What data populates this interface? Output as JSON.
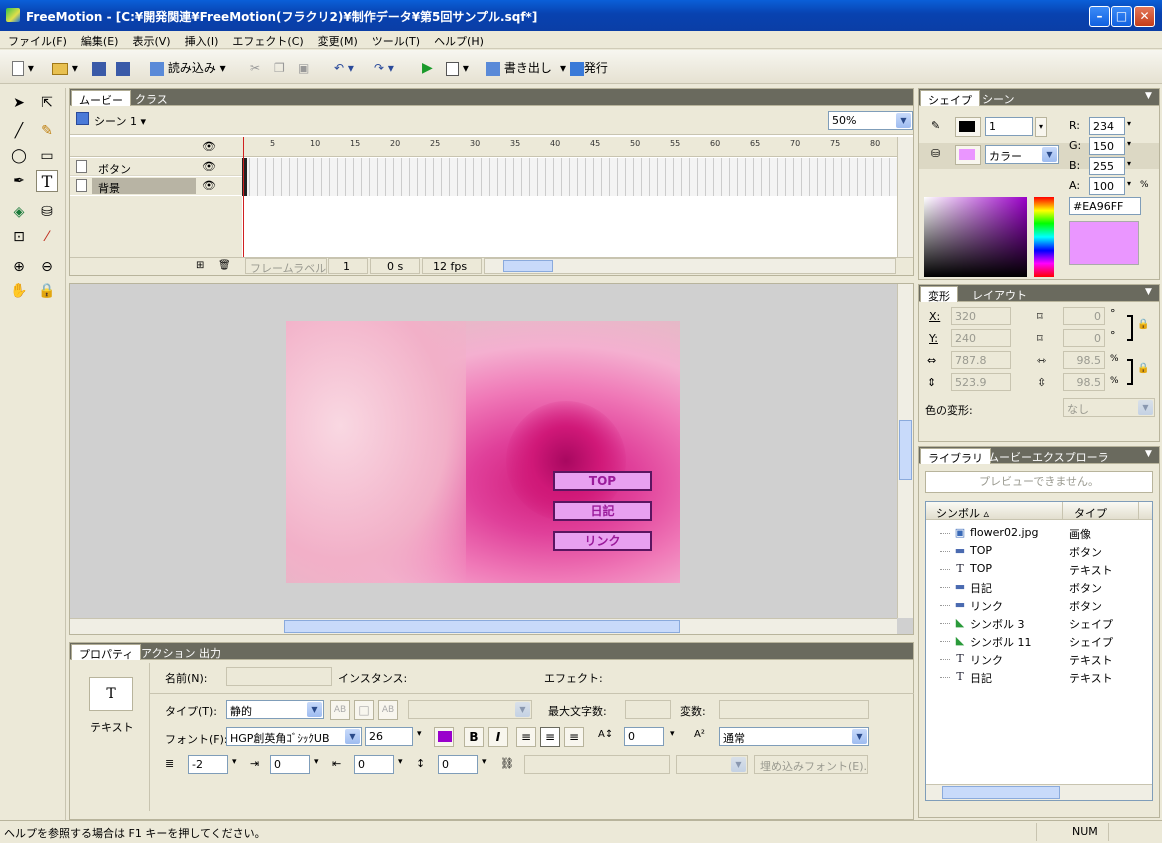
{
  "window": {
    "title": "FreeMotion - [C:¥開発関連¥FreeMotion(フラクリ2)¥制作データ¥第5回サンプル.sqf*]"
  },
  "menu": [
    "ファイル(F)",
    "編集(E)",
    "表示(V)",
    "挿入(I)",
    "エフェクト(C)",
    "変更(M)",
    "ツール(T)",
    "ヘルプ(H)"
  ],
  "toolbar": {
    "import_label": "読み込み",
    "export_label": "書き出し",
    "publish_label": "発行"
  },
  "movie_panel": {
    "tabs": [
      "ムービー",
      "クラス"
    ],
    "scene_label": "シーン 1",
    "zoom": "50%",
    "layers": [
      "ボタン",
      "背景"
    ],
    "ruler": [
      "5",
      "10",
      "15",
      "20",
      "25",
      "30",
      "35",
      "40",
      "45",
      "50",
      "55",
      "60",
      "65",
      "70",
      "75",
      "80"
    ],
    "frame_label_placeholder": "フレームラベル",
    "frame": "1",
    "time": "0 s",
    "fps": "12 fps"
  },
  "stage": {
    "buttons": [
      "TOP",
      "日記",
      "リンク"
    ]
  },
  "properties": {
    "tabs": [
      "プロパティ",
      "アクション",
      "出力"
    ],
    "object_type": "テキスト",
    "name_label": "名前(N):",
    "instance_label": "インスタンス:",
    "effect_label": "エフェクト:",
    "type_label": "タイプ(T):",
    "type_value": "静的",
    "maxchars_label": "最大文字数:",
    "var_label": "変数:",
    "font_label": "フォント(F):",
    "font_value": "HGP創英角ｺﾞｼｯｸUB",
    "font_size": "26",
    "spacing": "0",
    "baseline": "通常",
    "indent_left": "-2",
    "indent_a": "0",
    "indent_b": "0",
    "line_spacing": "0",
    "embed_font_label": "埋め込みフォント(E)..."
  },
  "shape_panel": {
    "tabs": [
      "シェイプ",
      "シーン"
    ],
    "stroke_width": "1",
    "fill_type": "カラー",
    "r_label": "R:",
    "g_label": "G:",
    "b_label": "B:",
    "a_label": "A:",
    "r": "234",
    "g": "150",
    "b": "255",
    "a": "100",
    "percent": "%",
    "hex": "#EA96FF",
    "swatch_color": "#EA96FF"
  },
  "transform_panel": {
    "tabs": [
      "変形",
      "レイアウト"
    ],
    "x_label": "X:",
    "y_label": "Y:",
    "x": "320",
    "y": "240",
    "w": "787.8",
    "h": "523.9",
    "skew_x": "0",
    "skew_y": "0",
    "scale_x": "98.5",
    "scale_y": "98.5",
    "deg": "°",
    "pct": "%",
    "color_transform_label": "色の変形:",
    "color_transform_value": "なし"
  },
  "library_panel": {
    "tabs": [
      "ライブラリ",
      "ムービーエクスプローラ"
    ],
    "preview_text": "プレビューできません。",
    "col_symbol": "シンボル",
    "col_type": "タイプ",
    "items": [
      {
        "name": "flower02.jpg",
        "type": "画像",
        "icon": "image-icon"
      },
      {
        "name": "TOP",
        "type": "ボタン",
        "icon": "button-icon"
      },
      {
        "name": "TOP",
        "type": "テキスト",
        "icon": "text-icon"
      },
      {
        "name": "日記",
        "type": "ボタン",
        "icon": "button-icon"
      },
      {
        "name": "リンク",
        "type": "ボタン",
        "icon": "button-icon"
      },
      {
        "name": "シンボル 3",
        "type": "シェイプ",
        "icon": "shape-icon"
      },
      {
        "name": "シンボル 11",
        "type": "シェイプ",
        "icon": "shape-icon"
      },
      {
        "name": "リンク",
        "type": "テキスト",
        "icon": "text-icon"
      },
      {
        "name": "日記",
        "type": "テキスト",
        "icon": "text-icon"
      }
    ]
  },
  "status": {
    "help": "ヘルプを参照する場合は F1 キーを押してください。",
    "num": "NUM"
  }
}
